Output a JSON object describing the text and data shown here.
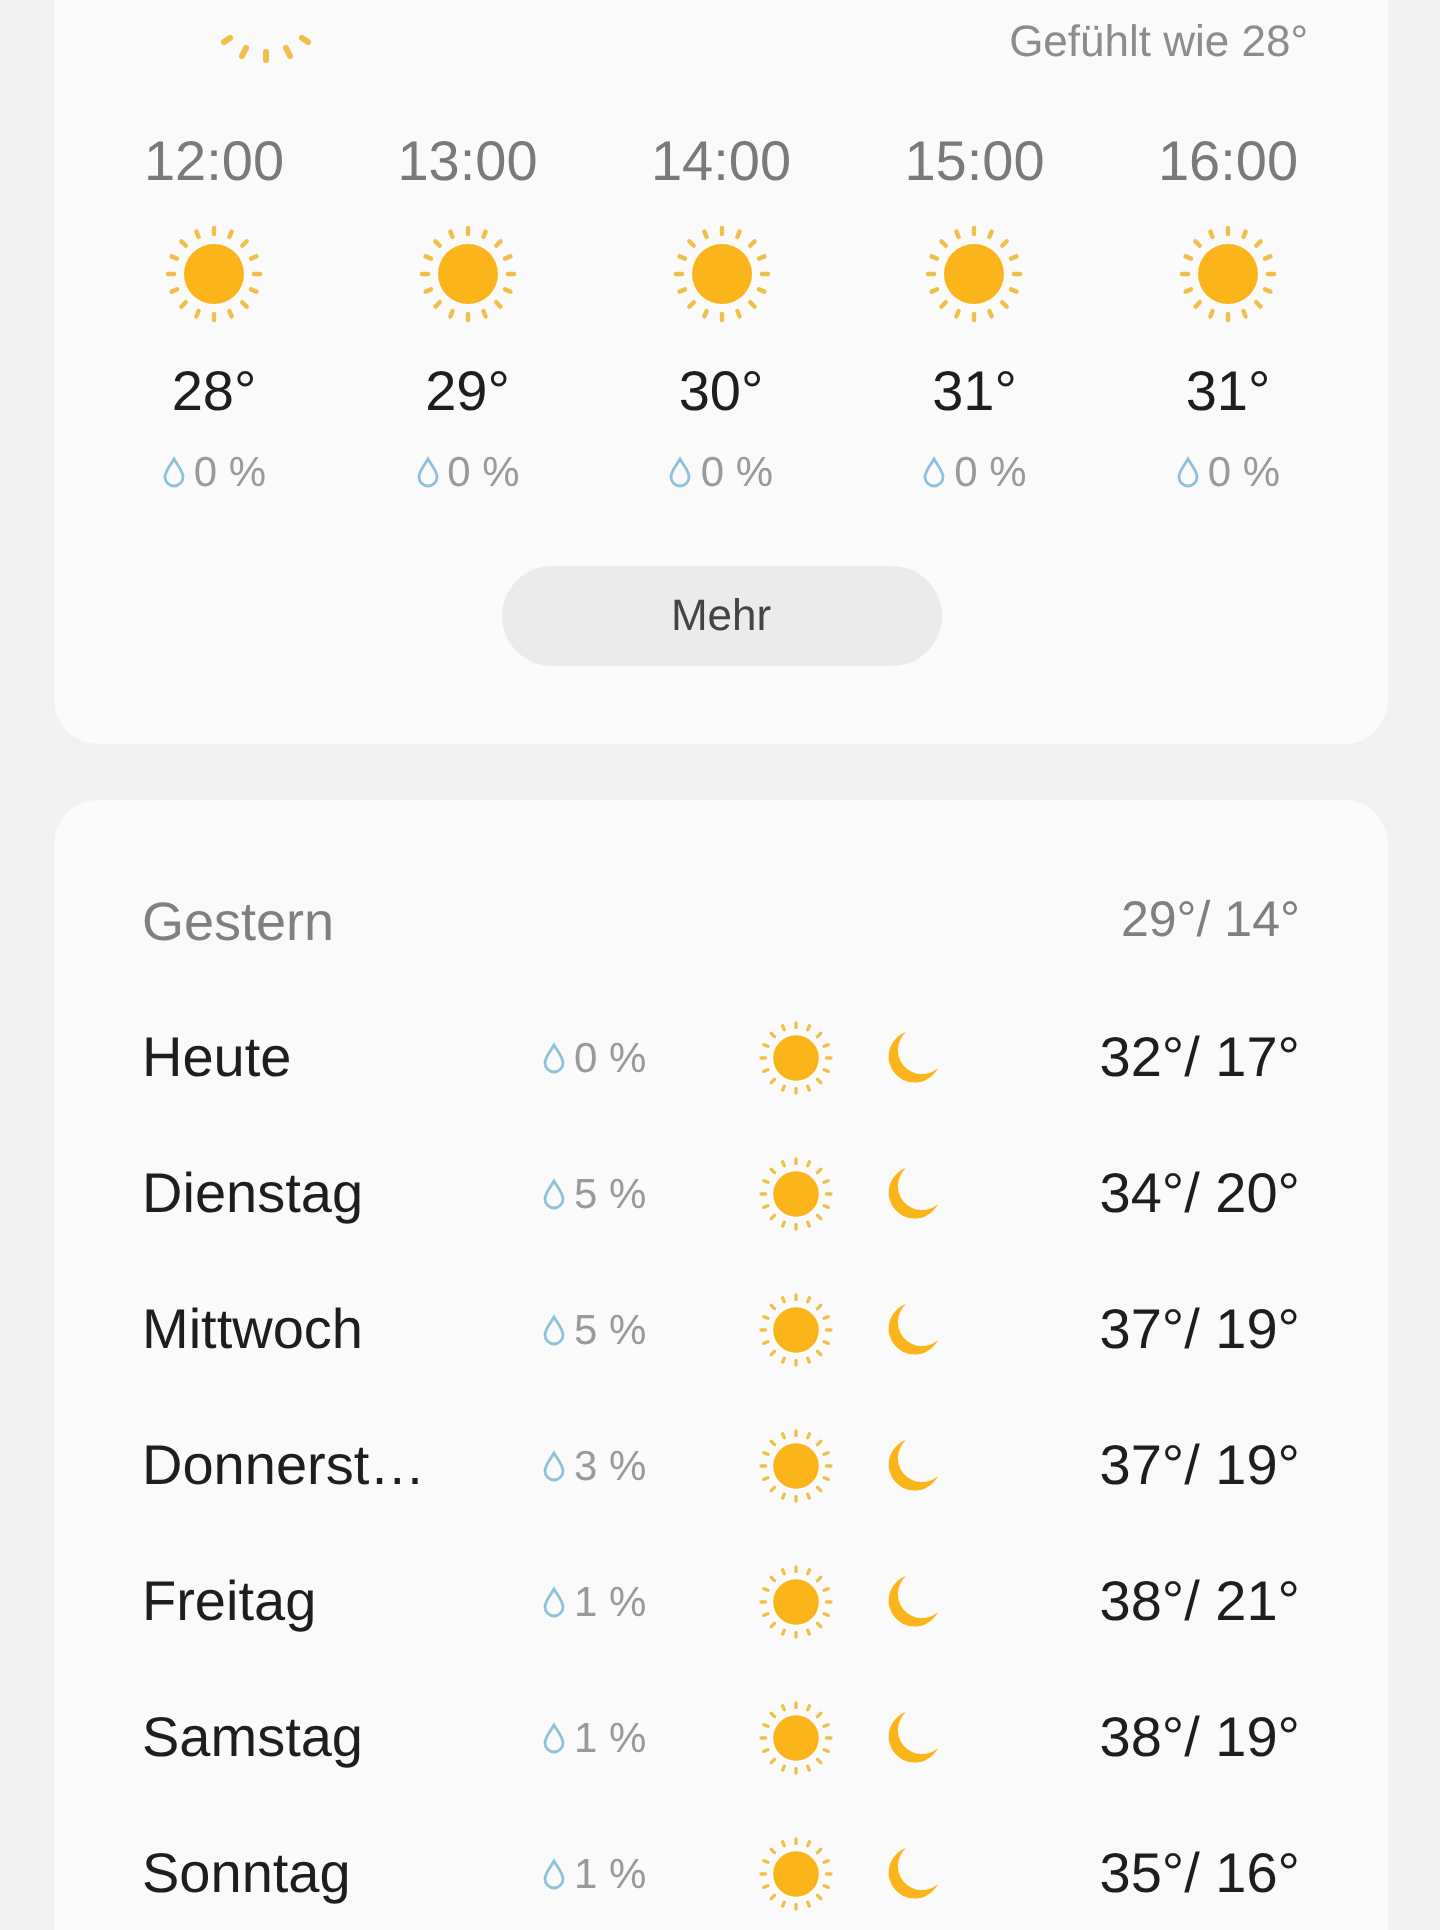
{
  "current": {
    "feels_like": "Gefühlt wie 28°"
  },
  "hourly": [
    {
      "time": "12:00",
      "temp": "28°",
      "precip": "0 %"
    },
    {
      "time": "13:00",
      "temp": "29°",
      "precip": "0 %"
    },
    {
      "time": "14:00",
      "temp": "30°",
      "precip": "0 %"
    },
    {
      "time": "15:00",
      "temp": "31°",
      "precip": "0 %"
    },
    {
      "time": "16:00",
      "temp": "31°",
      "precip": "0 %"
    }
  ],
  "more_button": "Mehr",
  "yesterday": {
    "label": "Gestern",
    "temps": "29°/ 14°"
  },
  "daily": [
    {
      "day": "Heute",
      "precip": "0 %",
      "temps": "32°/ 17°"
    },
    {
      "day": "Dienstag",
      "precip": "5 %",
      "temps": "34°/ 20°"
    },
    {
      "day": "Mittwoch",
      "precip": "5 %",
      "temps": "37°/ 19°"
    },
    {
      "day": "Donnerst…",
      "precip": "3 %",
      "temps": "37°/ 19°"
    },
    {
      "day": "Freitag",
      "precip": "1 %",
      "temps": "38°/ 21°"
    },
    {
      "day": "Samstag",
      "precip": "1 %",
      "temps": "38°/ 19°"
    },
    {
      "day": "Sonntag",
      "precip": "1 %",
      "temps": "35°/ 16°"
    }
  ]
}
